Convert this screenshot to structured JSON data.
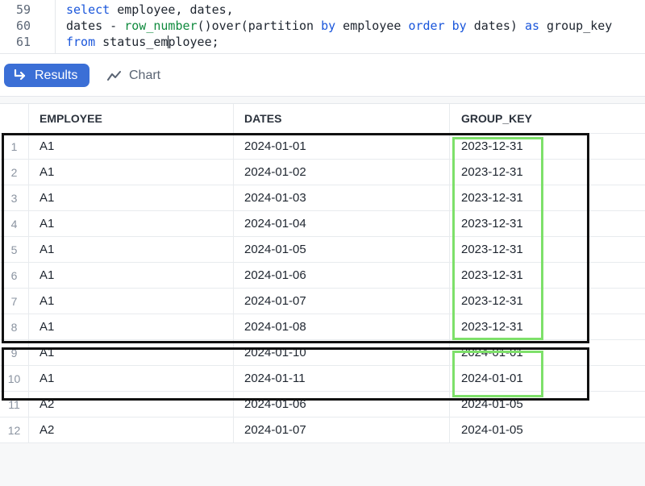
{
  "editor": {
    "lines": [
      {
        "no": "59",
        "parts": [
          {
            "t": "select",
            "c": "kw"
          },
          {
            "t": " employee, dates,",
            "c": ""
          }
        ]
      },
      {
        "no": "60",
        "parts": [
          {
            "t": "dates - ",
            "c": ""
          },
          {
            "t": "row_number",
            "c": "fn"
          },
          {
            "t": "()over(partition ",
            "c": ""
          },
          {
            "t": "by",
            "c": "kw"
          },
          {
            "t": " employee ",
            "c": ""
          },
          {
            "t": "order",
            "c": "kw"
          },
          {
            "t": " ",
            "c": ""
          },
          {
            "t": "by",
            "c": "kw"
          },
          {
            "t": " dates) ",
            "c": ""
          },
          {
            "t": "as",
            "c": "kw"
          },
          {
            "t": " group_key",
            "c": ""
          }
        ]
      },
      {
        "no": "61",
        "parts": [
          {
            "t": "from",
            "c": "kw"
          },
          {
            "t": " status_em",
            "c": ""
          },
          {
            "t": "|",
            "c": "caret"
          },
          {
            "t": "ployee;",
            "c": ""
          }
        ]
      }
    ]
  },
  "toolbar": {
    "results_label": "Results",
    "results_icon": "return-arrow-icon",
    "chart_label": "Chart",
    "chart_icon": "line-chart-icon",
    "accent": "#3b6fd6"
  },
  "table": {
    "columns": [
      "EMPLOYEE",
      "DATES",
      "GROUP_KEY"
    ],
    "rows": [
      {
        "idx": "1",
        "employee": "A1",
        "dates": "2024-01-01",
        "group_key": "2023-12-31"
      },
      {
        "idx": "2",
        "employee": "A1",
        "dates": "2024-01-02",
        "group_key": "2023-12-31"
      },
      {
        "idx": "3",
        "employee": "A1",
        "dates": "2024-01-03",
        "group_key": "2023-12-31"
      },
      {
        "idx": "4",
        "employee": "A1",
        "dates": "2024-01-04",
        "group_key": "2023-12-31"
      },
      {
        "idx": "5",
        "employee": "A1",
        "dates": "2024-01-05",
        "group_key": "2023-12-31"
      },
      {
        "idx": "6",
        "employee": "A1",
        "dates": "2024-01-06",
        "group_key": "2023-12-31"
      },
      {
        "idx": "7",
        "employee": "A1",
        "dates": "2024-01-07",
        "group_key": "2023-12-31"
      },
      {
        "idx": "8",
        "employee": "A1",
        "dates": "2024-01-08",
        "group_key": "2023-12-31"
      },
      {
        "idx": "9",
        "employee": "A1",
        "dates": "2024-01-10",
        "group_key": "2024-01-01"
      },
      {
        "idx": "10",
        "employee": "A1",
        "dates": "2024-01-11",
        "group_key": "2024-01-01"
      },
      {
        "idx": "11",
        "employee": "A2",
        "dates": "2024-01-06",
        "group_key": "2024-01-05"
      },
      {
        "idx": "12",
        "employee": "A2",
        "dates": "2024-01-07",
        "group_key": "2024-01-05"
      }
    ]
  },
  "annotations": {
    "outline_color": "#111111",
    "highlight_color": "#7ee06a"
  }
}
